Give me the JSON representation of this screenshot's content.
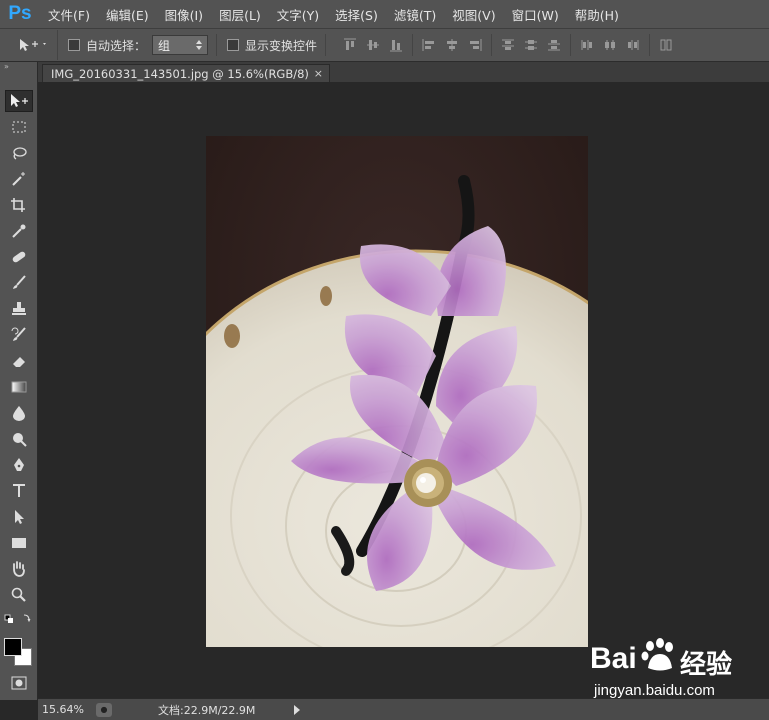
{
  "app": {
    "logo": "Ps"
  },
  "menu": {
    "items": [
      "文件(F)",
      "编辑(E)",
      "图像(I)",
      "图层(L)",
      "文字(Y)",
      "选择(S)",
      "滤镜(T)",
      "视图(V)",
      "窗口(W)",
      "帮助(H)"
    ]
  },
  "options": {
    "auto_select_label": "自动选择：",
    "auto_select_value": "组",
    "show_transform_label": "显示变换控件"
  },
  "document": {
    "tab_title": "IMG_20160331_143501.jpg @ 15.6%(RGB/8)",
    "close_glyph": "×"
  },
  "status": {
    "zoom": "15.64%",
    "doc_info": "文档:22.9M/22.9M"
  },
  "watermark": {
    "brand_left": "Bai",
    "brand_right": "经验",
    "url": "jingyan.baidu.com",
    "logo_name": "baidu-paw-icon"
  },
  "colors": {
    "chrome": "#535353",
    "canvas": "#282828",
    "accent": "#31a8ff"
  }
}
